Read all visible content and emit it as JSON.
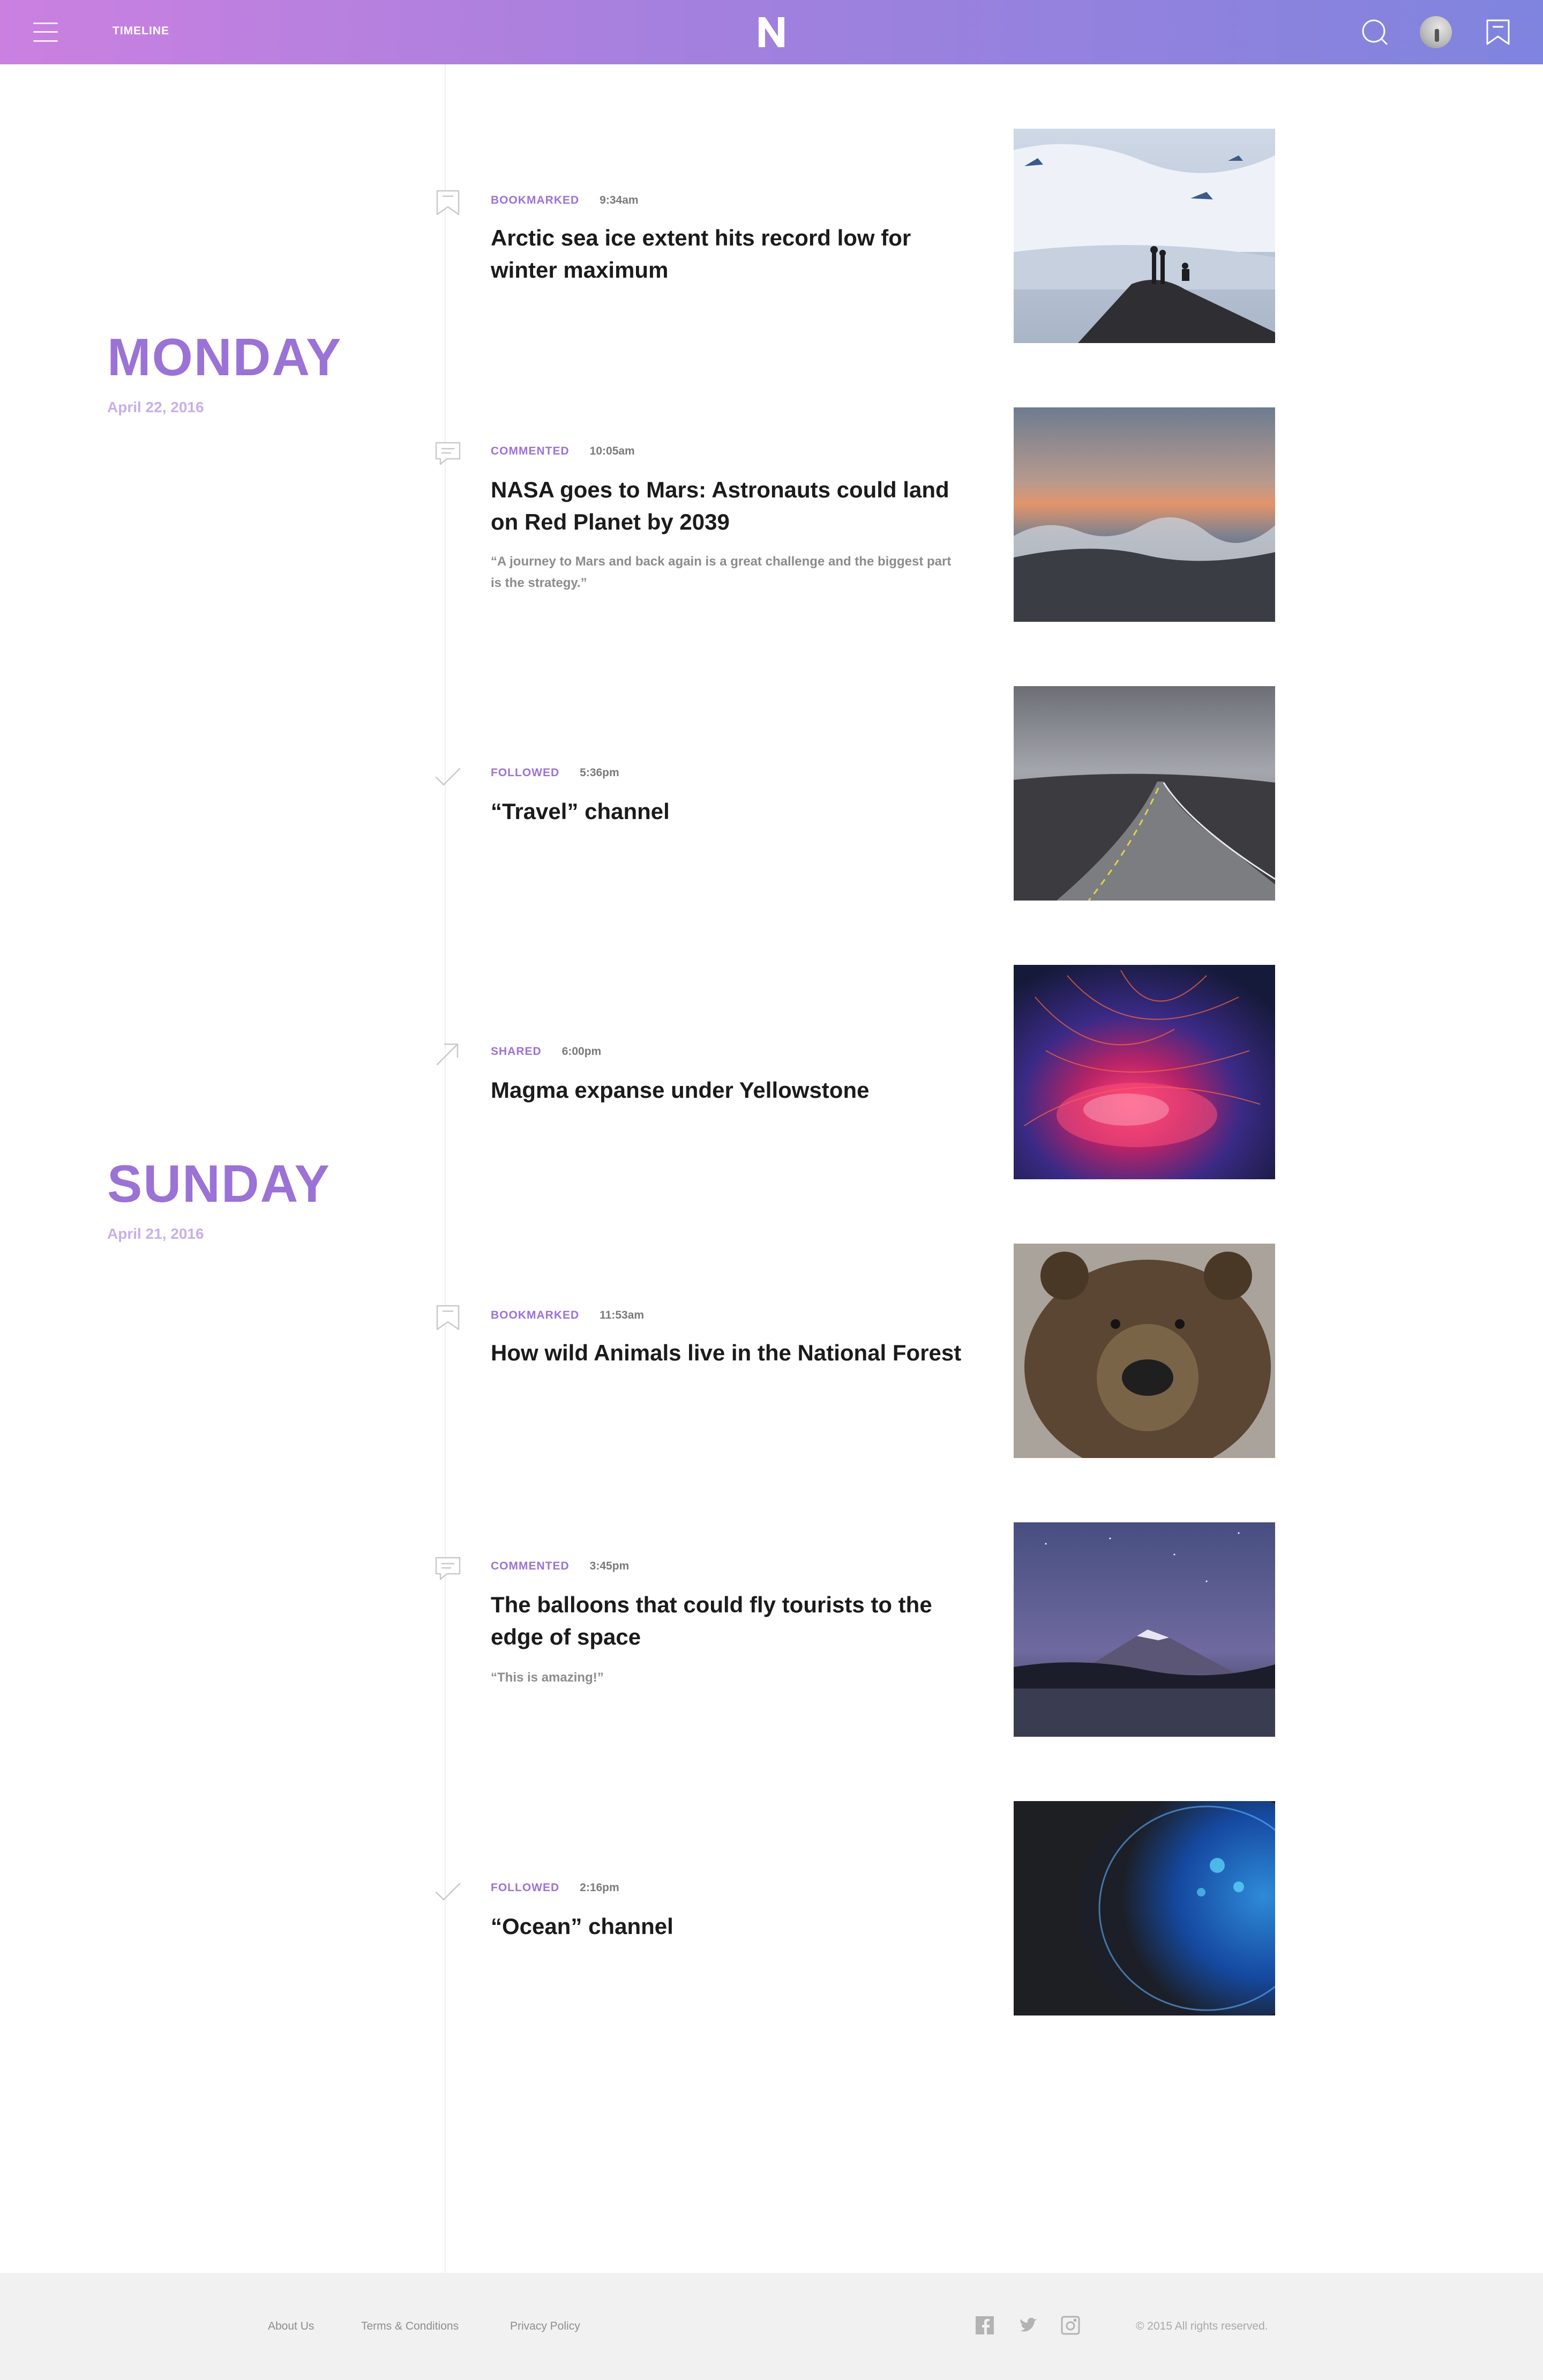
{
  "header": {
    "title": "TIMELINE",
    "logo": "N",
    "menu_icon": "menu-icon",
    "search_icon": "search-icon",
    "bookmark_icon": "bookmark-icon"
  },
  "colors": {
    "accent": "#9b72d6",
    "header_gradient_start": "#cb80e0",
    "header_gradient_end": "#7f84de"
  },
  "days": [
    {
      "name": "MONDAY",
      "date": "April 22, 2016"
    },
    {
      "name": "SUNDAY",
      "date": "April 21, 2016"
    }
  ],
  "entries": [
    {
      "type": "BOOKMARKED",
      "time": "9:34am",
      "icon": "bookmark-icon",
      "title": "Arctic sea ice extent hits record low for winter maximum",
      "comment": ""
    },
    {
      "type": "COMMENTED",
      "time": "10:05am",
      "icon": "comment-icon",
      "title": "NASA goes to Mars: Astronauts could land on Red Planet by 2039",
      "comment": "“A journey to Mars and back again is a great challenge and the biggest part is the strategy.”"
    },
    {
      "type": "FOLLOWED",
      "time": "5:36pm",
      "icon": "check-icon",
      "title": "“Travel” channel",
      "comment": ""
    },
    {
      "type": "SHARED",
      "time": "6:00pm",
      "icon": "share-arrow-icon",
      "title": "Magma expanse under Yellowstone",
      "comment": ""
    },
    {
      "type": "BOOKMARKED",
      "time": "11:53am",
      "icon": "bookmark-icon",
      "title": "How wild Animals live in the National Forest",
      "comment": ""
    },
    {
      "type": "COMMENTED",
      "time": "3:45pm",
      "icon": "comment-icon",
      "title": "The balloons that could fly tourists to the edge of space",
      "comment": "“This is amazing!”"
    },
    {
      "type": "FOLLOWED",
      "time": "2:16pm",
      "icon": "check-icon",
      "title": "“Ocean” channel",
      "comment": ""
    }
  ],
  "footer": {
    "links": [
      "About Us",
      "Terms & Conditions",
      "Privacy Policy"
    ],
    "social": [
      "facebook-icon",
      "twitter-icon",
      "instagram-icon"
    ],
    "copyright": "© 2015 All rights reserved."
  }
}
